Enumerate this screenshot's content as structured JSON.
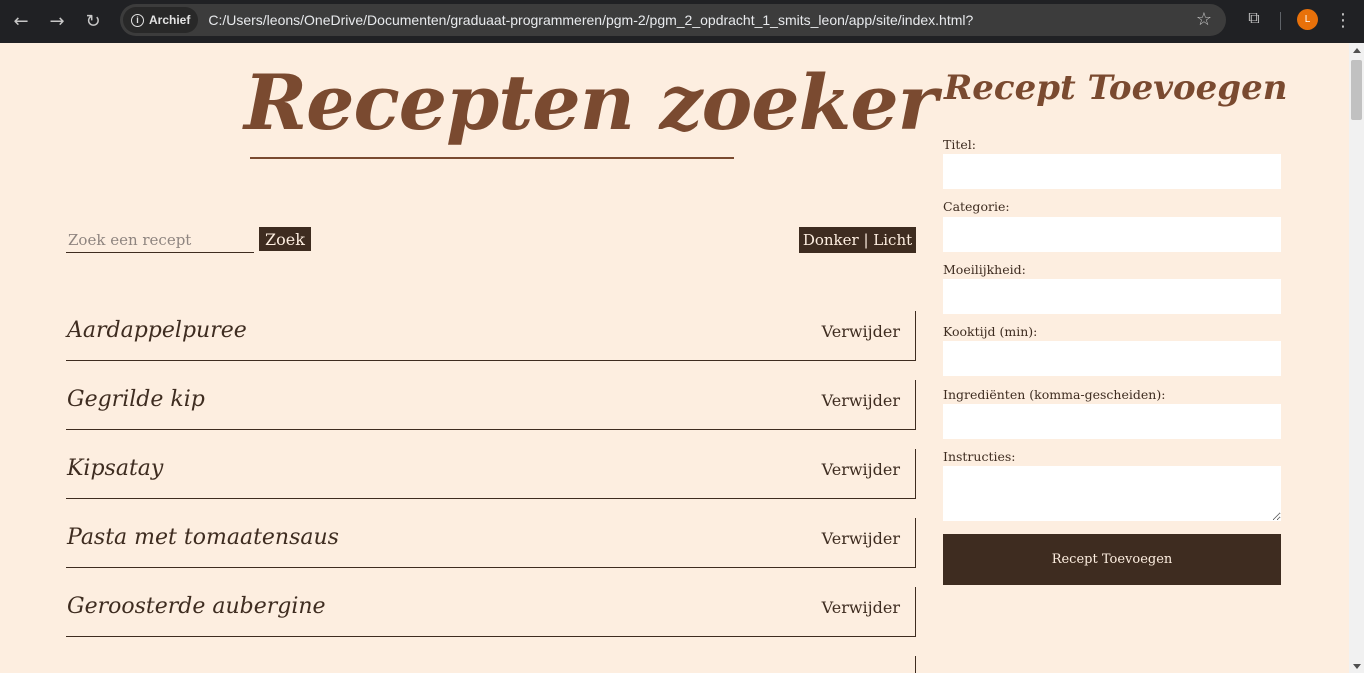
{
  "browser": {
    "badge": "Archief",
    "url": "C:/Users/leons/OneDrive/Documenten/graduaat-programmeren/pgm-2/pgm_2_opdracht_1_smits_leon/app/site/index.html?",
    "avatar_initial": "L"
  },
  "page": {
    "title": "Recepten zoeker",
    "search_placeholder": "Zoek een recept",
    "search_button": "Zoek",
    "theme_toggle": "Donker | Licht"
  },
  "recipes": [
    {
      "name": "Aardappelpuree",
      "delete": "Verwijder"
    },
    {
      "name": "Gegrilde kip",
      "delete": "Verwijder"
    },
    {
      "name": "Kipsatay",
      "delete": "Verwijder"
    },
    {
      "name": "Pasta met tomaatensaus",
      "delete": "Verwijder"
    },
    {
      "name": "Geroosterde aubergine",
      "delete": "Verwijder"
    }
  ],
  "form": {
    "title": "Recept Toevoegen",
    "labels": {
      "titel": "Titel:",
      "categorie": "Categorie:",
      "moeilijkheid": "Moeilijkheid:",
      "kooktijd": "Kooktijd (min):",
      "ingredienten": "Ingrediënten (komma-gescheiden):",
      "instructies": "Instructies:"
    },
    "submit": "Recept Toevoegen"
  },
  "colors": {
    "background": "#fdeee0",
    "accent_dark": "#3e2c20",
    "title_brown": "#7a4a30"
  }
}
